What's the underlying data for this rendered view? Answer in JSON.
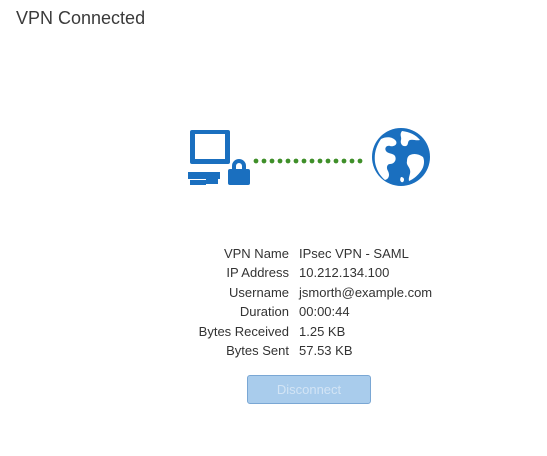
{
  "header": {
    "title": "VPN Connected"
  },
  "graphic": {
    "left_icon": "computer-lock-icon",
    "connector": "dotted-connection-line",
    "right_icon": "globe-icon",
    "icon_color": "#1a6fbf",
    "connector_color": "#3f8f29"
  },
  "details": [
    {
      "label": "VPN Name",
      "value": "IPsec VPN - SAML"
    },
    {
      "label": "IP Address",
      "value": "10.212.134.100"
    },
    {
      "label": "Username",
      "value": "jsmorth@example.com"
    },
    {
      "label": "Duration",
      "value": "00:00:44"
    },
    {
      "label": "Bytes Received",
      "value": "1.25 KB"
    },
    {
      "label": "Bytes Sent",
      "value": "57.53 KB"
    }
  ],
  "actions": {
    "disconnect_label": "Disconnect"
  },
  "colors": {
    "button_bg": "#a9ccec",
    "button_border": "#7aa7d4"
  }
}
